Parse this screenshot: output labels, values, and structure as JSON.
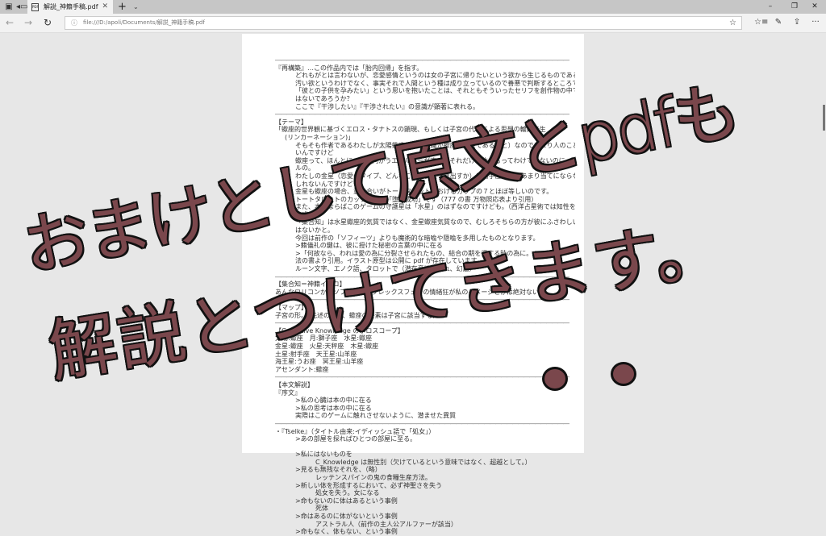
{
  "browser": {
    "tab_title": "解説_神籍手稿.pdf",
    "tab_close": "✕",
    "new_tab": "+",
    "tab_list": "⌄",
    "address": "file:///D:/apoli/Documents/解説_神籍手稿.pdf",
    "window_controls": {
      "minimize": "–",
      "restore": "❐",
      "close": "✕"
    },
    "more": "···"
  },
  "document": {
    "lines": [
      {
        "c": "rule",
        "t": "――――――――――――――――――――――――――――――――――――――――――――――――――――"
      },
      {
        "c": "",
        "t": "『再構築』…この作品内では「胎内回帰」を指す。"
      },
      {
        "c": "i2",
        "t": "どれもがとは言わないが、恋愛感情というのは女の子宮に帰りたいという欲から生じるものである"
      },
      {
        "c": "i2",
        "t": "汚い欲というわけでなく、事実それで人間という種は成り立っているので善悪で判断するところではない。"
      },
      {
        "c": "i2",
        "t": "「彼との子供を孕みたい」という思いを抱いたことは、それともそういったセリフを創作物の中で聞いたこと"
      },
      {
        "c": "i2",
        "t": "はないであろうか？"
      },
      {
        "c": "i2",
        "t": "ここで『干渉したい』『干渉されたい』の意識が顕著に表れる。"
      },
      {
        "c": "rule",
        "t": "――――――――――――――――――――――――――――――――――――――――――――――――――――"
      },
      {
        "c": "",
        "t": "【テーマ】"
      },
      {
        "c": "",
        "t": "「蠍座的世界観に基づくエロス・タナトスの顕現、もしくは子宮の代替による思想の輪廻転生"
      },
      {
        "c": "i1",
        "t": "(リンカーネーション)」"
      },
      {
        "c": "i2",
        "t": "そもそも作者であるわたしが太陽蠍座（表層意識が蠍座的気質であること）なのであまり人のこと言えな"
      },
      {
        "c": "i2",
        "t": "いんですけど"
      },
      {
        "c": "i2",
        "t": "蠍座って、ほんとに一つに向かうエネルギーが凄い。それだけで生きるってわけでもないのにってレベ"
      },
      {
        "c": "i2",
        "t": "ルの。"
      },
      {
        "c": "i2",
        "t": "わたしの金星（恋愛のタイプ、どんなことに快楽を見出すか）は射手座なのであまり当てにならないかも"
      },
      {
        "c": "i2",
        "t": "しれないんですけども。"
      },
      {
        "c": "i2",
        "t": "金星も蠍座の場合、意味合いがトートタロットにおけるカップの７とほぼ等しいのです。"
      },
      {
        "c": "i2",
        "t": "トートタロットのカップの７は「堕落成功」です（777 の書 万物照応表より引用）"
      },
      {
        "c": "i2",
        "t": "また、本来ならばこのゲームの守護星は「水星」のはずなのですけども。（西洋占星術では知性を表"
      },
      {
        "c": "i2",
        "t": "す惑星）"
      },
      {
        "c": "i2",
        "t": "「集合知」は水星蠍座的気質ではなく、金星蠍座気質なので、むしろそちらの方が彼にふさわしいので"
      },
      {
        "c": "i2",
        "t": "はないかと。"
      },
      {
        "c": "i2",
        "t": "今回は前作の「ソフィーツ」よりも魔術的な暗喩や隠喩を多用したものとなります。"
      },
      {
        "c": "i2",
        "t": ">籍儀礼の鍵は、彼に授けた秘密の言葉の中に在る"
      },
      {
        "c": "i2",
        "t": ">「何故なら、われは愛の為に分裂させられたもの、結合の期を得する時の為に。"
      },
      {
        "c": "i2",
        "t": "法の書より引用。イラスト原型は公開に pdf が存在しています"
      },
      {
        "c": "i2",
        "t": "ルーン文字、エノク語、タロットで（潜在意識、畏れ、幻惑）"
      },
      {
        "c": "rule",
        "t": "――――――――――――――――――――――――――――――――――――――――――――――――――――"
      },
      {
        "c": "",
        "t": "【集合知＝神籍イタコ】"
      },
      {
        "c": "",
        "t": "あんなロリコンかつソフィアコンプレックスフェチの情緒狂が私のイメージとかは絶対ない"
      },
      {
        "c": "rule",
        "t": "――――――――――――――――――――――――――――――――――――――――――――――――――――"
      },
      {
        "c": "",
        "t": "【マップ】"
      },
      {
        "c": "",
        "t": "子宮の形。（先述の通り、蠍座の要素は子宮に該当する）"
      },
      {
        "c": "rule",
        "t": "――――――――――――――――――――――――――――――――――――――――――――――――――――"
      },
      {
        "c": "",
        "t": "【Collective Knowledge のホロスコープ】"
      },
      {
        "c": "",
        "t": "太陽:蠍座　月:獅子座　水星:蠍座"
      },
      {
        "c": "",
        "t": "金星:蠍座　火星:天秤座　木星:蠍座"
      },
      {
        "c": "",
        "t": "土星:射手座　天王星:山羊座"
      },
      {
        "c": "",
        "t": "海王星:うお座　冥王星:山羊座"
      },
      {
        "c": "",
        "t": "アセンダント:蠍座"
      },
      {
        "c": "rule",
        "t": "――――――――――――――――――――――――――――――――――――――――――――――――――――"
      },
      {
        "c": "",
        "t": "【本文解説】"
      },
      {
        "c": "",
        "t": "『序文』"
      },
      {
        "c": "i2",
        "t": ">私の心臓は本の中に在る"
      },
      {
        "c": "i2",
        "t": ">私の思考は本の中に在る"
      },
      {
        "c": "i2",
        "t": "実際はこのゲームに触れさせないように、潜ませた異質"
      },
      {
        "c": "rule",
        "t": "――――――――――――――――――――――――――――――――――――――――――――――――――――"
      },
      {
        "c": "",
        "t": "・『Tselke』（タイトル由来:イディッシュ語で「処女」）"
      },
      {
        "c": "i2",
        "t": ">あの部屋を探ればひとつの部屋に至る。"
      },
      {
        "c": "",
        "t": " "
      },
      {
        "c": "i2",
        "t": ">私にはないものを"
      },
      {
        "c": "i3",
        "t": "C_Knowledge は無性別（欠けているという意味ではなく、超越として。）"
      },
      {
        "c": "i2",
        "t": ">見るも無残なそれを、（略）"
      },
      {
        "c": "i3",
        "t": "レッテンスパインの鬼の食糧生産方法。"
      },
      {
        "c": "i2",
        "t": ">新しい体を形成するにおいて、必ず神聖さを失う"
      },
      {
        "c": "i3",
        "t": "処女を失う。女になる"
      },
      {
        "c": "i2",
        "t": ">命もないのに体はあるという事例"
      },
      {
        "c": "i3",
        "t": "死体"
      },
      {
        "c": "i2",
        "t": ">命はあるのに体がないという事例"
      },
      {
        "c": "i3",
        "t": "アストラル人（前作の主人公アルファーが該当）"
      },
      {
        "c": "i2",
        "t": ">命もなく、体もない、という事例"
      }
    ]
  },
  "overlay": {
    "line1": "おまけとして原文とpdfも",
    "line2": "解説とつけてきます。"
  },
  "colors": {
    "handwriting": "#7a474c",
    "outline": "#111111"
  }
}
